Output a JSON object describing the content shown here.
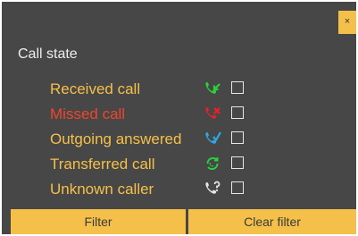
{
  "close_label": "×",
  "section_title": "Call state",
  "items": [
    {
      "label": "Received call",
      "label_color": "#f5c04a",
      "icon": "received-call-icon",
      "icon_color": "#29d13d"
    },
    {
      "label": "Missed call",
      "label_color": "#f0452c",
      "icon": "missed-call-icon",
      "icon_color": "#e8202a"
    },
    {
      "label": "Outgoing answered",
      "label_color": "#f5c04a",
      "icon": "outgoing-answered-icon",
      "icon_color": "#2aa8e8"
    },
    {
      "label": "Transferred call",
      "label_color": "#f5c04a",
      "icon": "transferred-call-icon",
      "icon_color": "#29d13d"
    },
    {
      "label": "Unknown caller",
      "label_color": "#f5c04a",
      "icon": "unknown-caller-icon",
      "icon_color": "#e6e6e6"
    }
  ],
  "buttons": {
    "filter": "Filter",
    "clear_filter": "Clear filter"
  },
  "colors": {
    "panel_bg": "#474747",
    "accent": "#f5c04a"
  }
}
